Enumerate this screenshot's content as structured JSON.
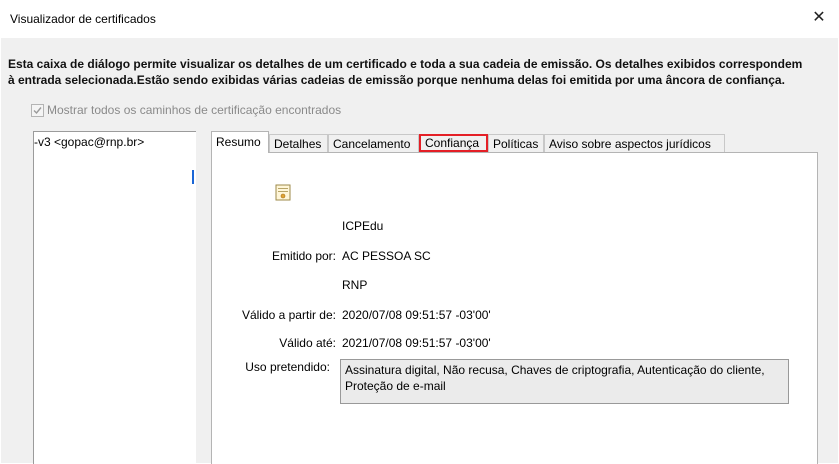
{
  "window": {
    "title": "Visualizador de certificados",
    "close_glyph": "✕"
  },
  "intro": {
    "line1": "Esta caixa de diálogo permite visualizar os detalhes de um certificado e toda a sua cadeia de emissão. Os detalhes exibidos correspondem",
    "line2": "à entrada selecionada.Estão sendo exibidas várias cadeias de emissão porque nenhuma delas foi emitida por uma âncora de confiança."
  },
  "show_all_paths": {
    "label": "Mostrar todos os caminhos de certificação encontrados",
    "checked": true,
    "enabled": false
  },
  "tree": {
    "items": [
      "-v3 <gopac@rnp.br>"
    ]
  },
  "tabs": [
    "Resumo",
    "Detalhes",
    "Cancelamento",
    "Confiança",
    "Políticas",
    "Aviso sobre aspectos jurídicos"
  ],
  "active_tab": "Resumo",
  "highlighted_tab": "Confiança",
  "summary": {
    "icon": "certificate-icon",
    "subject": "ICPEdu",
    "issued_by_label": "Emitido por:",
    "issued_by": "AC PESSOA SC",
    "issuer_org": "RNP",
    "valid_from_label": "Válido a partir de:",
    "valid_from": "2020/07/08 09:51:57 -03'00'",
    "valid_until_label": "Válido até:",
    "valid_until": "2021/07/08 09:51:57 -03'00'",
    "usage_label": "Uso pretendido:",
    "usage_line1": "Assinatura digital, Não recusa, Chaves de criptografia, Autenticação do cliente,",
    "usage_line2": "Proteção de e-mail"
  },
  "colors": {
    "highlight_border": "#e41f26",
    "selection": "#1a66d6"
  }
}
